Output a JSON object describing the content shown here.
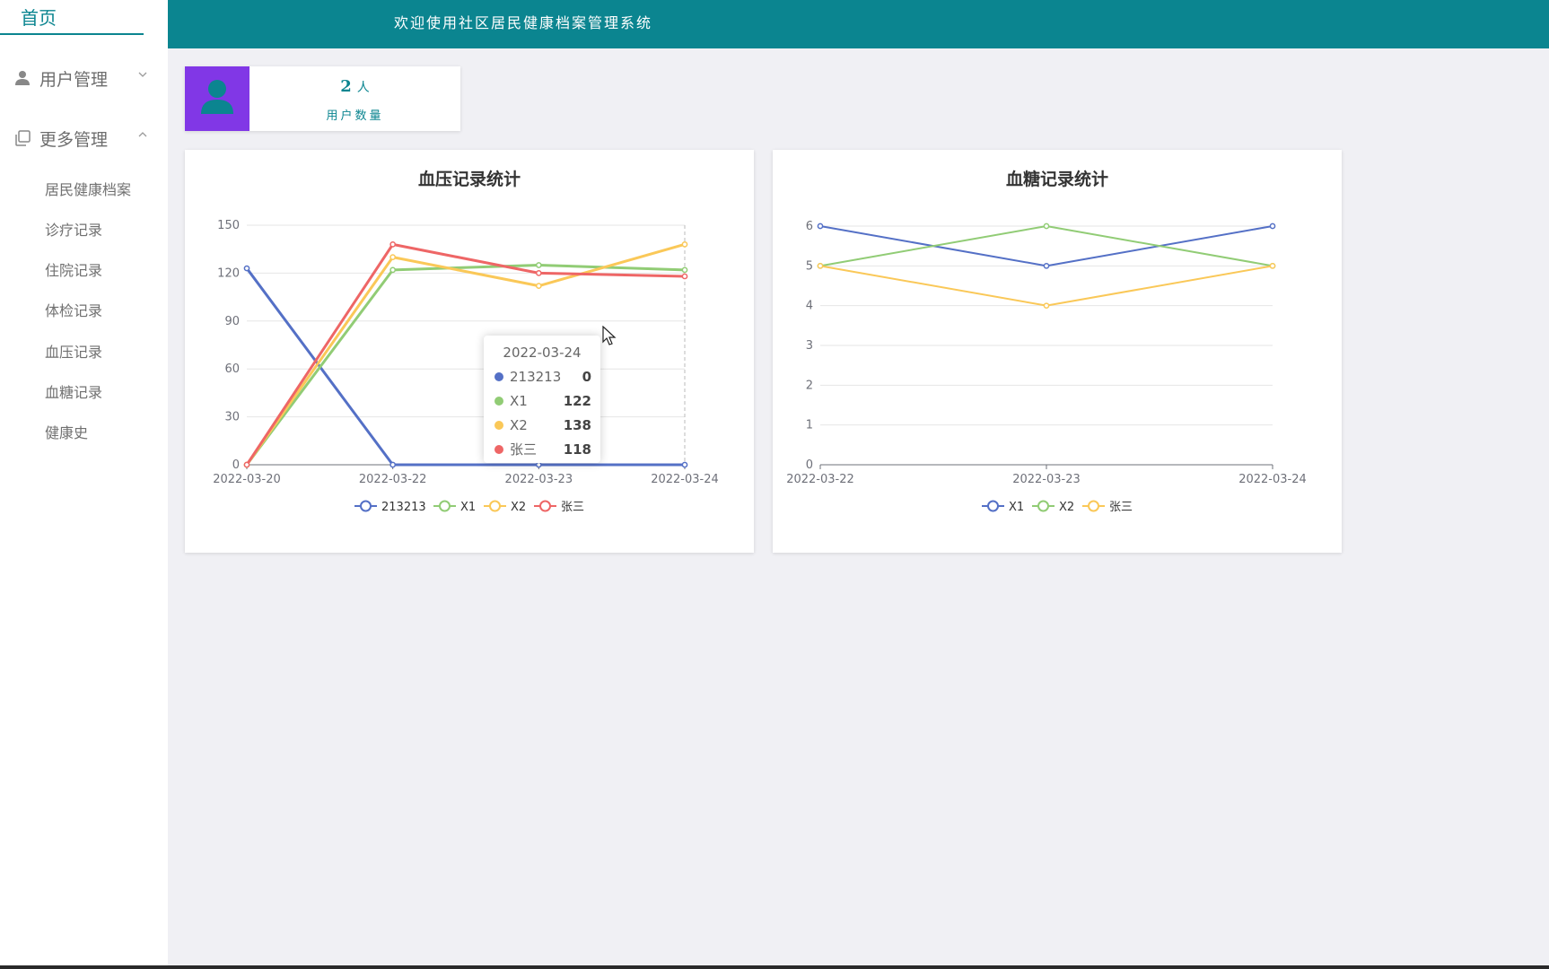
{
  "sidebar": {
    "home_label": "首页",
    "menus": [
      {
        "label": "用户管理",
        "icon": "user-icon",
        "expanded": false
      },
      {
        "label": "更多管理",
        "icon": "copy-icon",
        "expanded": true
      }
    ],
    "sub_items": [
      "居民健康档案",
      "诊疗记录",
      "住院记录",
      "体检记录",
      "血压记录",
      "血糖记录",
      "健康史"
    ]
  },
  "header": {
    "title": "欢迎使用社区居民健康档案管理系统"
  },
  "stat": {
    "value": "2",
    "unit": "人",
    "label": "用户数量",
    "icon": "user-icon",
    "color": "#8137e6"
  },
  "colors": {
    "accent": "#0b8590",
    "blue": "#5470c6",
    "green": "#91cc75",
    "yellow": "#fac858",
    "red": "#ee6666"
  },
  "chart_data": [
    {
      "type": "line",
      "title": "血压记录统计",
      "categories": [
        "2022-03-20",
        "2022-03-22",
        "2022-03-23",
        "2022-03-24"
      ],
      "ylim": [
        0,
        150
      ],
      "yticks": [
        0,
        30,
        60,
        90,
        120,
        150
      ],
      "grid": true,
      "legend_position": "bottom",
      "series": [
        {
          "name": "213213",
          "values": [
            123,
            0,
            0,
            0
          ],
          "color": "#5470c6"
        },
        {
          "name": "X1",
          "values": [
            0,
            122,
            125,
            122
          ],
          "color": "#91cc75"
        },
        {
          "name": "X2",
          "values": [
            0,
            130,
            112,
            138
          ],
          "color": "#fac858"
        },
        {
          "name": "张三",
          "values": [
            0,
            138,
            120,
            118
          ],
          "color": "#ee6666"
        }
      ],
      "tooltip": {
        "title": "2022-03-24",
        "rows": [
          {
            "name": "213213",
            "value": "0",
            "color": "#5470c6"
          },
          {
            "name": "X1",
            "value": "122",
            "color": "#91cc75"
          },
          {
            "name": "X2",
            "value": "138",
            "color": "#fac858"
          },
          {
            "name": "张三",
            "value": "118",
            "color": "#ee6666"
          }
        ]
      }
    },
    {
      "type": "line",
      "title": "血糖记录统计",
      "categories": [
        "2022-03-22",
        "2022-03-23",
        "2022-03-24"
      ],
      "ylim": [
        0,
        6
      ],
      "yticks": [
        0,
        1,
        2,
        3,
        4,
        5,
        6
      ],
      "grid": true,
      "legend_position": "bottom",
      "series": [
        {
          "name": "X1",
          "values": [
            6,
            5,
            6
          ],
          "color": "#5470c6"
        },
        {
          "name": "X2",
          "values": [
            5,
            6,
            5
          ],
          "color": "#91cc75"
        },
        {
          "name": "张三",
          "values": [
            5,
            4,
            5
          ],
          "color": "#fac858"
        }
      ]
    }
  ]
}
